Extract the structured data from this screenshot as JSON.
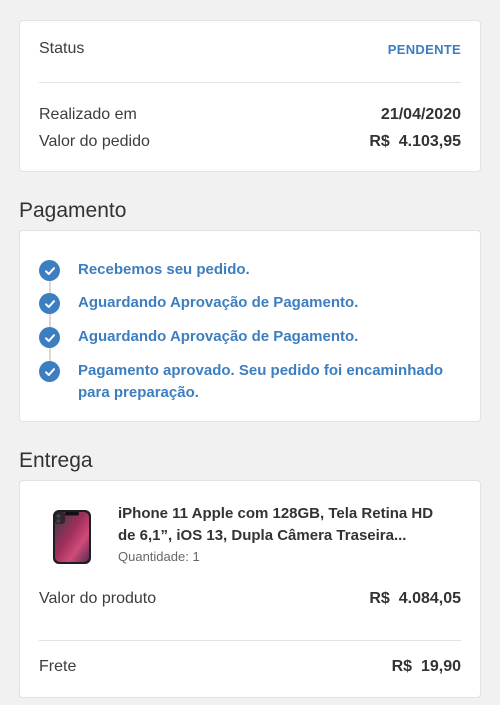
{
  "summary": {
    "status_label": "Status",
    "status_value": "PENDENTE",
    "date_label": "Realizado em",
    "date_value": "21/04/2020",
    "order_value_label": "Valor do pedido",
    "order_value": "R$  4.103,95"
  },
  "payment": {
    "title": "Pagamento",
    "steps": [
      {
        "text": "Recebemos seu pedido."
      },
      {
        "text": "Aguardando Aprovação de Pagamento."
      },
      {
        "text": "Aguardando Aprovação de Pagamento."
      },
      {
        "text": "Pagamento aprovado. Seu pedido foi encaminhado para preparação."
      }
    ]
  },
  "delivery": {
    "title": "Entrega",
    "product": {
      "name": "iPhone 11 Apple com 128GB, Tela Retina HD de 6,1”, iOS 13, Dupla Câmera Traseira...",
      "quantity": "Quantidade: 1",
      "image_icon": "iphone-product-icon"
    },
    "product_value_label": "Valor do produto",
    "product_value": "R$  4.084,05",
    "shipping_label": "Frete",
    "shipping_value": "R$  19,90"
  },
  "colors": {
    "accent": "#3d7ec1",
    "background": "#f1f1f1",
    "card": "#ffffff"
  }
}
